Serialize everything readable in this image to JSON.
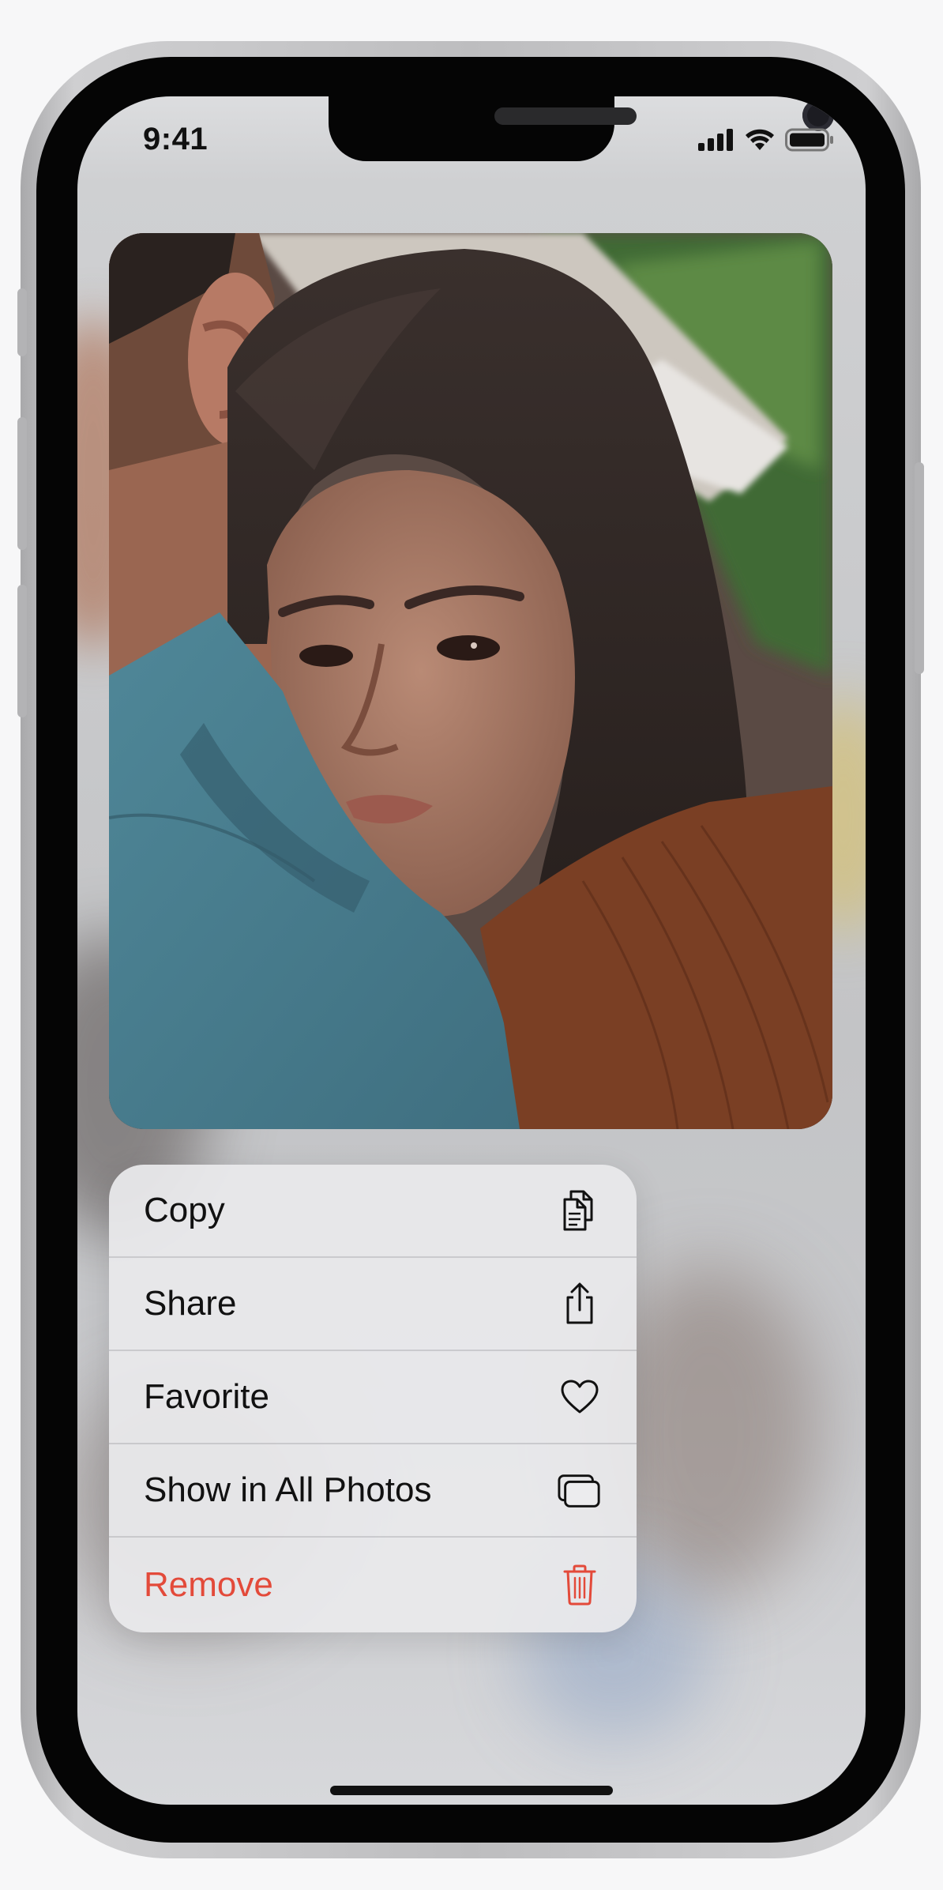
{
  "status_bar": {
    "time": "9:41",
    "icons": [
      "cellular-signal-icon",
      "wifi-icon",
      "battery-icon"
    ]
  },
  "photo": {
    "subject": "portrait-photo"
  },
  "context_menu": {
    "items": [
      {
        "label": "Copy",
        "icon": "copy-icon",
        "destructive": false
      },
      {
        "label": "Share",
        "icon": "share-icon",
        "destructive": false
      },
      {
        "label": "Favorite",
        "icon": "heart-icon",
        "destructive": false
      },
      {
        "label": "Show in All Photos",
        "icon": "photos-stack-icon",
        "destructive": false
      },
      {
        "label": "Remove",
        "icon": "trash-icon",
        "destructive": true
      }
    ]
  },
  "colors": {
    "destructive": "#e34a3a",
    "label": "#111111",
    "menu_background": "#eaeaec"
  }
}
